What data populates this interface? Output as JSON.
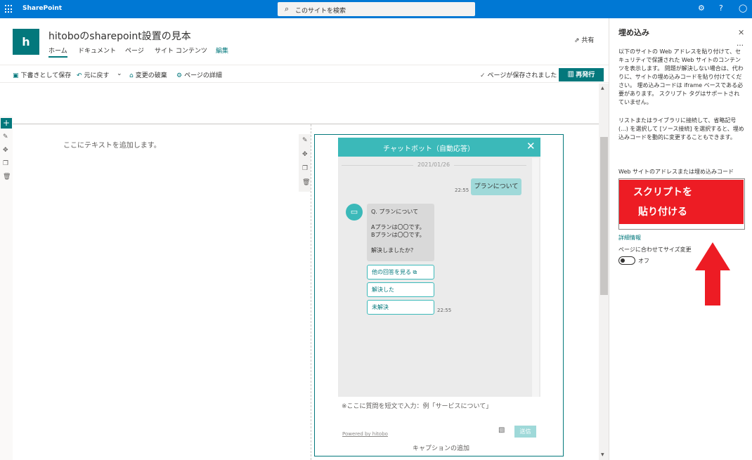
{
  "suite": {
    "app_name": "SharePoint",
    "search_placeholder": "このサイトを検索",
    "icons": [
      "waffle-icon",
      "gear-icon",
      "help-icon",
      "person-icon"
    ]
  },
  "site": {
    "logo_letter": "h",
    "title": "hitoboのsharepoint設置の見本",
    "nav": [
      "ホーム",
      "ドキュメント",
      "ページ",
      "サイト コンテンツ",
      "編集"
    ],
    "share_label": "共有"
  },
  "commandbar": {
    "save_draft": "下書きとして保存",
    "undo": "元に戻す",
    "discard": "変更の破棄",
    "page_details": "ページの詳細",
    "saved_status": "ページが保存されました",
    "republish": "再発行"
  },
  "canvas": {
    "text_placeholder": "ここにテキストを追加します。",
    "caption_placeholder": "キャプションの追加"
  },
  "chat": {
    "title": "チャットボット（自動応答）",
    "date": "2021/01/26",
    "user_message": "プランについて",
    "user_time": "22:55",
    "bot_lines": [
      "Q. プランについて",
      "",
      "Aプランは〇〇です。",
      "Bプランは〇〇です。",
      "",
      "解決しましたか？"
    ],
    "options": [
      "他の回答を見る",
      "解決した",
      "未解決"
    ],
    "bot_time": "22:55",
    "input_placeholder": "※ここに質問を短文で入力：例「サービスについて」",
    "powered_by": "Powered by hitobo",
    "send_label": "送信"
  },
  "pane": {
    "title": "埋め込み",
    "description1": "以下のサイトの Web アドレスを貼り付けて、セキュリティで保護された Web サイトのコンテンツを表示します。 問題が解決しない場合は、代わりに、サイトの埋め込みコードを貼り付けてください。 埋め込みコードは iframe ベースである必要があります。 スクリプト タグはサポートされていません。",
    "description2": "リストまたはライブラリに接続して、省略記号 (...) を選択して [ソース接続] を選択すると、埋め込みコードを動的に変更することもできます。",
    "field_label": "Web サイトのアドレスまたは埋め込みコード",
    "overlay_line1": "スクリプトを",
    "overlay_line2": "貼り付ける",
    "detail_link": "詳細情報",
    "resize_label": "ページに合わせてサイズ変更",
    "toggle_state": "オフ"
  },
  "colors": {
    "suite_blue": "#0078d4",
    "theme_teal": "#03787c",
    "chat_teal": "#3bb9b9",
    "annotation_red": "#ed1c24"
  }
}
